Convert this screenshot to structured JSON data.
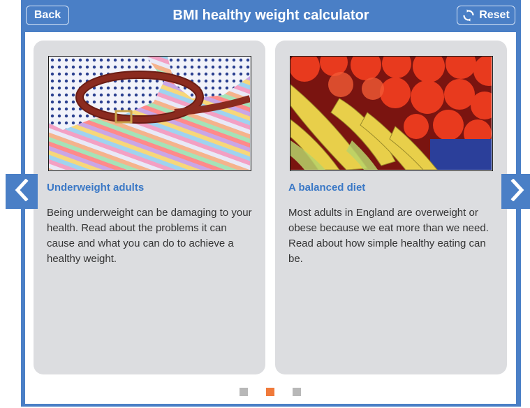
{
  "header": {
    "title": "BMI healthy weight calculator",
    "back_label": "Back",
    "reset_label": "Reset"
  },
  "cards": [
    {
      "title": "Underweight adults",
      "body": "Being underweight can be damaging to your health. Read about the problems it can cause and what you can do to achieve a healthy weight."
    },
    {
      "title": "A balanced diet",
      "body": "Most adults in England are overweight or obese because we eat more than we need. Read about how simple healthy eating can be."
    }
  ],
  "carousel": {
    "page_count": 3,
    "active_page": 2
  },
  "colors": {
    "brand_blue": "#4a7fc6",
    "link_blue": "#3a78c6",
    "card_bg": "#dcdde0",
    "active_dot": "#f07a3a",
    "inactive_dot": "#b8b8b8"
  },
  "icons": {
    "reset": "refresh-icon",
    "prev": "chevron-left-icon",
    "next": "chevron-right-icon"
  }
}
